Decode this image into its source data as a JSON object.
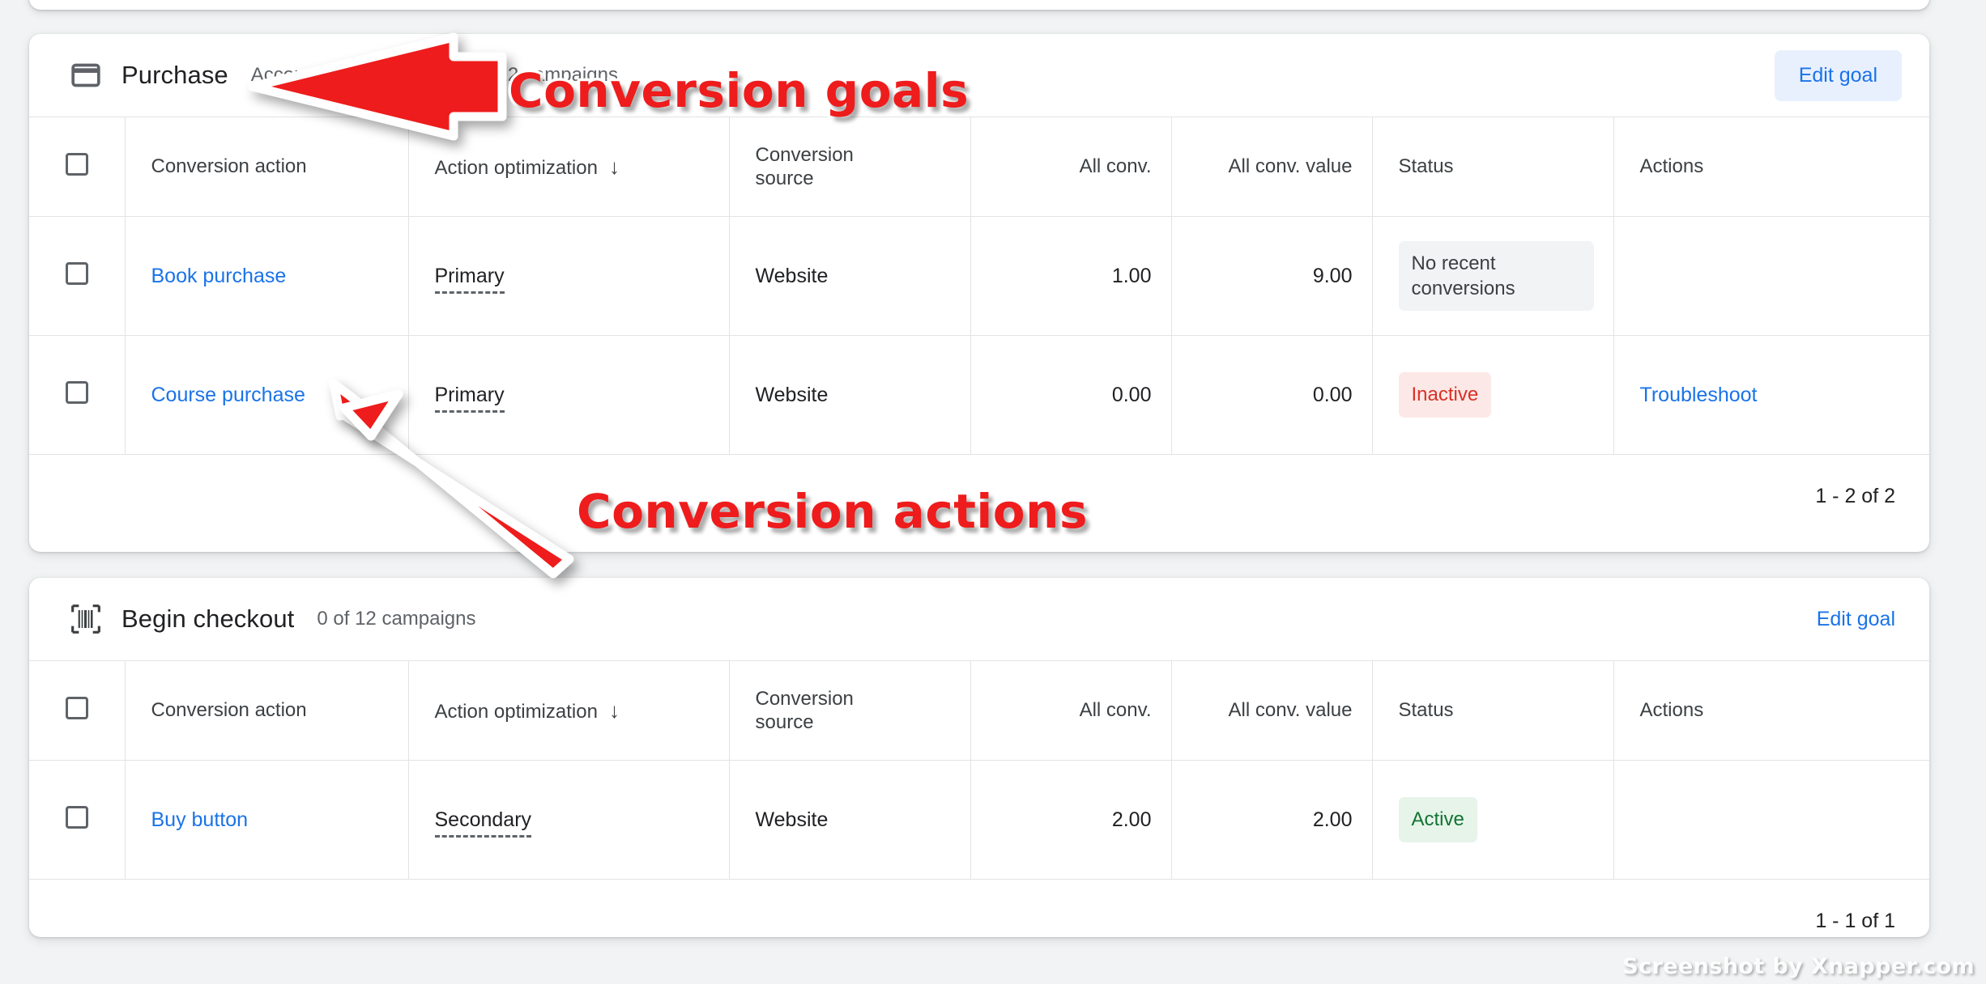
{
  "watermark": "Screenshot by Xnapper.com",
  "annotations": [
    {
      "id": "goals",
      "text": "Conversion goals",
      "color": "#ee1c1c"
    },
    {
      "id": "actions",
      "text": "Conversion actions",
      "color": "#ee1c1c"
    }
  ],
  "columns": {
    "conversion_action": "Conversion action",
    "action_optimization": "Action optimization",
    "sort_arrow": "↓",
    "conversion_source": "Conversion\nsource",
    "conversion_source_l1": "Conversion",
    "conversion_source_l2": "source",
    "all_conv": "All conv.",
    "all_conv_value": "All conv. value",
    "status": "Status",
    "actions": "Actions"
  },
  "goals": [
    {
      "icon": "credit-card-icon",
      "title": "Purchase",
      "meta_default": "Account default goal",
      "meta_campaigns": "11 of 12 campaigns",
      "edit_label": "Edit goal",
      "edit_style": "button",
      "pagination": "1 - 2 of 2",
      "rows": [
        {
          "name": "Book purchase",
          "optimization": "Primary",
          "source": "Website",
          "all_conv": "1.00",
          "all_conv_value": "9.00",
          "status": "No recent conversions",
          "status_type": "neutral",
          "action": ""
        },
        {
          "name": "Course purchase",
          "optimization": "Primary",
          "source": "Website",
          "all_conv": "0.00",
          "all_conv_value": "0.00",
          "status": "Inactive",
          "status_type": "inactive",
          "action": "Troubleshoot"
        }
      ]
    },
    {
      "icon": "barcode-icon",
      "title": "Begin checkout",
      "meta_default": "",
      "meta_campaigns": "0 of 12 campaigns",
      "edit_label": "Edit goal",
      "edit_style": "link",
      "pagination": "1 - 1 of 1",
      "rows": [
        {
          "name": "Buy button",
          "optimization": "Secondary",
          "source": "Website",
          "all_conv": "2.00",
          "all_conv_value": "2.00",
          "status": "Active",
          "status_type": "active",
          "action": ""
        }
      ]
    }
  ],
  "colors": {
    "link": "#1a73e8",
    "badge_active": "#137333",
    "badge_inactive": "#d93025",
    "annotation_red": "#ee1c1c"
  }
}
